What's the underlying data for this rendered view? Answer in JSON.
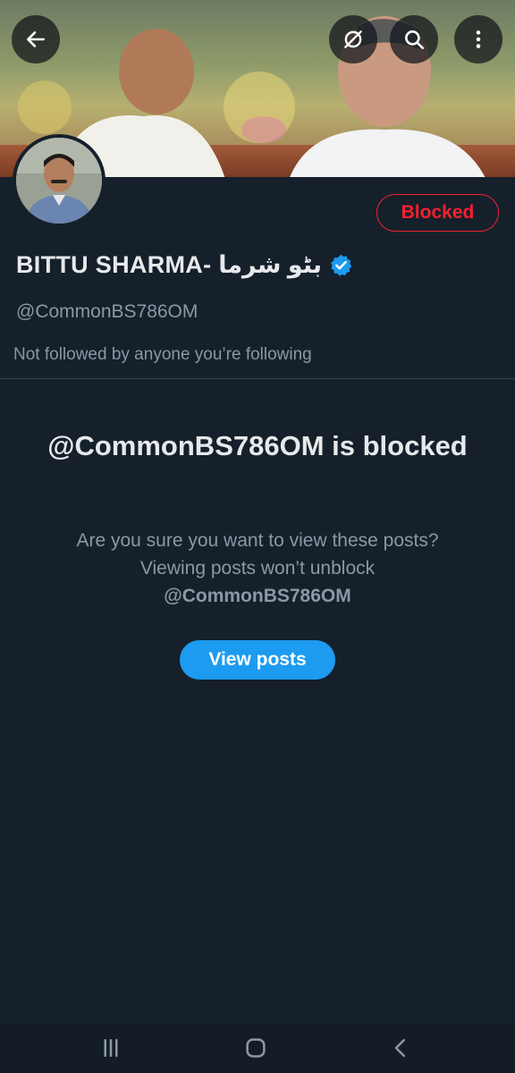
{
  "header": {
    "back_icon": "arrow-left-icon",
    "grok_icon": "grok-icon",
    "search_icon": "search-icon",
    "more_icon": "more-vertical-icon"
  },
  "profile": {
    "name": "BITTU SHARMA- بٹو شرما",
    "handle": "@CommonBS786OM",
    "verified": true,
    "followed_status": "Not followed by anyone you’re following",
    "blocked_label": "Blocked"
  },
  "blocked_notice": {
    "title": "@CommonBS786OM is blocked",
    "desc_text": "Are you sure you want to view these posts? Viewing posts won’t unblock",
    "desc_handle": "@CommonBS786OM",
    "view_button": "View posts"
  },
  "nav": {
    "recents_icon": "recents-icon",
    "home_icon": "home-icon",
    "back_icon": "back-chevron-icon"
  },
  "colors": {
    "background": "#15202b",
    "accent": "#1d9bf0",
    "danger": "#f4212e",
    "secondary_text": "#8b98a5"
  }
}
